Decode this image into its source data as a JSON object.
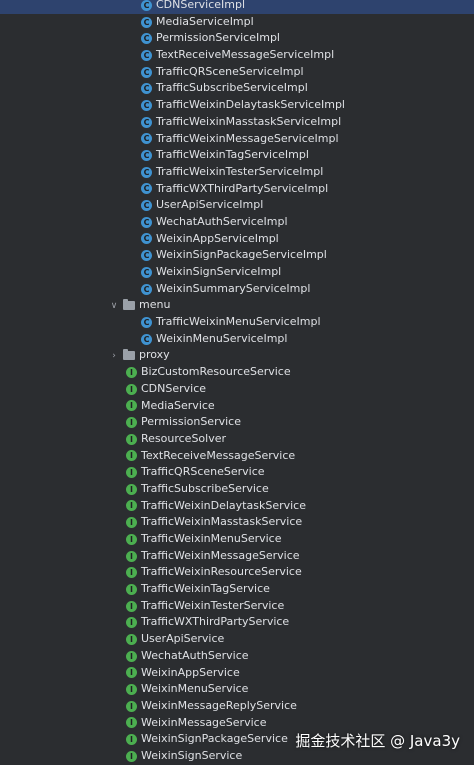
{
  "impl_items": [
    "CDNServiceImpl",
    "MediaServiceImpl",
    "PermissionServiceImpl",
    "TextReceiveMessageServiceImpl",
    "TrafficQRSceneServiceImpl",
    "TrafficSubscribeServiceImpl",
    "TrafficWeixinDelaytaskServiceImpl",
    "TrafficWeixinMasstaskServiceImpl",
    "TrafficWeixinMessageServiceImpl",
    "TrafficWeixinTagServiceImpl",
    "TrafficWeixinTesterServiceImpl",
    "TrafficWXThirdPartyServiceImpl",
    "UserApiServiceImpl",
    "WechatAuthServiceImpl",
    "WeixinAppServiceImpl",
    "WeixinSignPackageServiceImpl",
    "WeixinSignServiceImpl",
    "WeixinSummaryServiceImpl"
  ],
  "menu_folder": {
    "label": "menu",
    "items": [
      "TrafficWeixinMenuServiceImpl",
      "WeixinMenuServiceImpl"
    ]
  },
  "proxy_folder": {
    "label": "proxy"
  },
  "interfaces": [
    "BizCustomResourceService",
    "CDNService",
    "MediaService",
    "PermissionService",
    "ResourceSolver",
    "TextReceiveMessageService",
    "TrafficQRSceneService",
    "TrafficSubscribeService",
    "TrafficWeixinDelaytaskService",
    "TrafficWeixinMasstaskService",
    "TrafficWeixinMenuService",
    "TrafficWeixinMessageService",
    "TrafficWeixinResourceService",
    "TrafficWeixinTagService",
    "TrafficWeixinTesterService",
    "TrafficWXThirdPartyService",
    "UserApiService",
    "WechatAuthService",
    "WeixinAppService",
    "WeixinMenuService",
    "WeixinMessageReplyService",
    "WeixinMessageService",
    "WeixinSignPackageService",
    "WeixinSignService"
  ],
  "icons": {
    "class": "class-icon",
    "interface": "interface-icon",
    "folder": "folder-icon",
    "expanded": "chevron-down-icon",
    "collapsed": "chevron-right-icon"
  },
  "colors": {
    "background": "#2b2d30",
    "class_icon": "#3f93d1",
    "interface_icon": "#4caf50"
  },
  "watermark": "掘金技术社区 @ Java3y"
}
